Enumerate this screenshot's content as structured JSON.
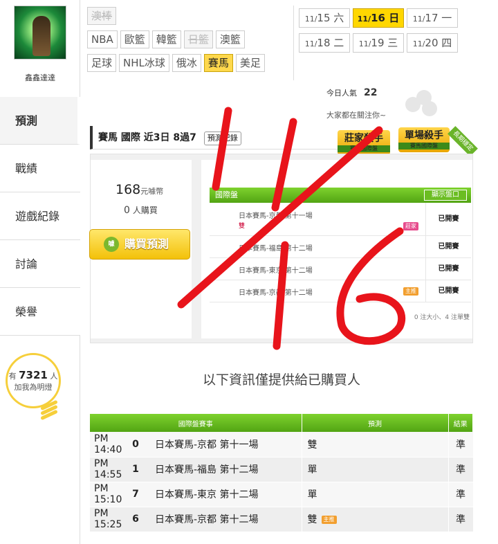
{
  "user": {
    "name": "鑫鑫達達"
  },
  "sidebar": {
    "items": [
      {
        "label": "預測",
        "active": true
      },
      {
        "label": "戰績"
      },
      {
        "label": "遊戲紀錄"
      },
      {
        "label": "討論"
      },
      {
        "label": "榮譽"
      }
    ],
    "fans": {
      "prefix": "有",
      "count": "7321",
      "unit": "人",
      "text": "加我為明燈"
    }
  },
  "sports": [
    {
      "label": "澳棒",
      "state": "disabled"
    },
    {
      "label": "NBA"
    },
    {
      "label": "歐籃"
    },
    {
      "label": "韓籃"
    },
    {
      "label": "日籃",
      "state": "disabled"
    },
    {
      "label": "澳籃"
    },
    {
      "label": "足球"
    },
    {
      "label": "NHL冰球"
    },
    {
      "label": "俄冰"
    },
    {
      "label": "賽馬",
      "state": "active"
    },
    {
      "label": "美足"
    }
  ],
  "dates": [
    {
      "date": "11/",
      "day": "15",
      "weekday": "六"
    },
    {
      "date": "11/",
      "day": "16",
      "weekday": "日",
      "active": true
    },
    {
      "date": "11/",
      "day": "17",
      "weekday": "一"
    },
    {
      "date": "11/",
      "day": "18",
      "weekday": "二"
    },
    {
      "date": "11/",
      "day": "19",
      "weekday": "三"
    },
    {
      "date": "11/",
      "day": "20",
      "weekday": "四"
    }
  ],
  "popularity": {
    "label": "今日人氣",
    "value": "22",
    "follow_text": "大家都在關注你~"
  },
  "title": {
    "text": "賽馬 國際 近3日 8過7",
    "record_btn": "預測紀錄"
  },
  "badges": {
    "b1": {
      "title": "莊家殺手",
      "sub": "賽馬國際盤"
    },
    "b2": {
      "title": "單場殺手",
      "sub": "賽馬國際盤"
    },
    "ribbon": "長期穩定"
  },
  "purchase": {
    "price": "168",
    "price_unit": "元噱幣",
    "buyers": "0",
    "buyers_unit": "人購買",
    "button": "購買預測",
    "icon_text": "噱"
  },
  "games_panel": {
    "header": "國際盤",
    "odds_button": "顯示盤口",
    "rows": [
      {
        "name": "日本賽馬-京都 第十一場",
        "pick": "雙",
        "tag": "莊家",
        "status": "已開賽"
      },
      {
        "name": "日本賽馬-福島 第十二場",
        "pick": "",
        "tag": "",
        "status": "已開賽"
      },
      {
        "name": "日本賽馬-東京 第十二場",
        "pick": "",
        "tag": "",
        "status": "已開賽"
      },
      {
        "name": "日本賽馬-京都 第十二場",
        "pick": "",
        "tag": "主推",
        "status": "已開賽"
      }
    ],
    "note": "0 注大小、4 注單雙"
  },
  "info_message": "以下資訊僅提供給已購買人",
  "results": {
    "headers": [
      "國際盤賽事",
      "預測",
      "結果"
    ],
    "rows": [
      {
        "time": "PM 14:40",
        "num": "0",
        "game": "日本賽馬-京都 第十一場",
        "pick": "雙",
        "tag": "",
        "result": "準"
      },
      {
        "time": "PM 14:55",
        "num": "1",
        "game": "日本賽馬-福島 第十二場",
        "pick": "單",
        "tag": "",
        "result": "準"
      },
      {
        "time": "PM 15:10",
        "num": "7",
        "game": "日本賽馬-東京 第十二場",
        "pick": "單",
        "tag": "",
        "result": "準"
      },
      {
        "time": "PM 15:25",
        "num": "6",
        "game": "日本賽馬-京都 第十二場",
        "pick": "雙",
        "tag": "主推",
        "result": "準"
      }
    ]
  },
  "annotation": {
    "text": "11/16",
    "color": "#e8141b"
  }
}
